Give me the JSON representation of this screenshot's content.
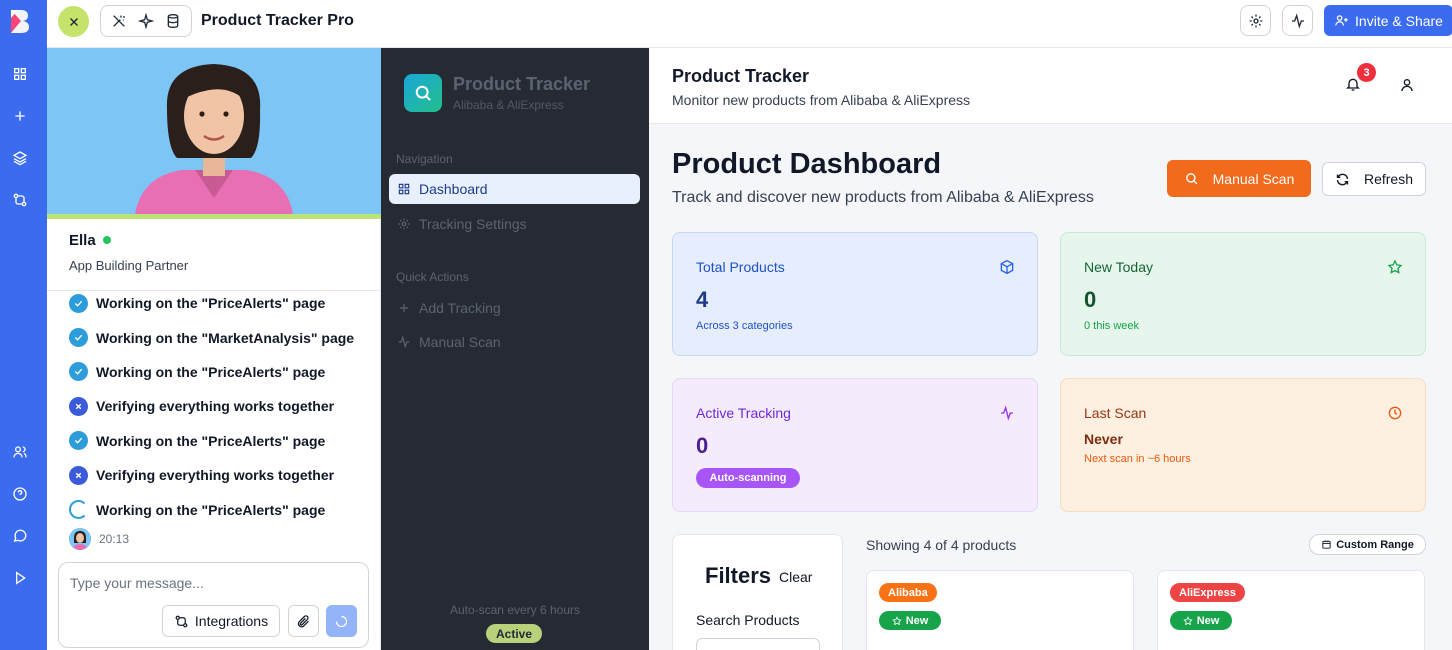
{
  "topbar": {
    "app_title": "Product Tracker Pro",
    "invite_label": "Invite & Share"
  },
  "agent": {
    "name": "Ella",
    "role": "App Building Partner",
    "steps": [
      {
        "status": "done",
        "label": "Working on the \"PriceAlerts\" page"
      },
      {
        "status": "done",
        "label": "Working on the \"MarketAnalysis\" page"
      },
      {
        "status": "done",
        "label": "Working on the \"PriceAlerts\" page"
      },
      {
        "status": "failed",
        "label": "Verifying everything works together"
      },
      {
        "status": "done",
        "label": "Working on the \"PriceAlerts\" page"
      },
      {
        "status": "failed",
        "label": "Verifying everything works together"
      },
      {
        "status": "in-progress",
        "label": "Working on the \"PriceAlerts\" page"
      }
    ],
    "message_time": "20:13",
    "composer": {
      "placeholder": "Type your message...",
      "integrations_label": "Integrations"
    }
  },
  "sidebar": {
    "brand_name": "Product Tracker",
    "brand_sub": "Alibaba & AliExpress",
    "nav_heading": "Navigation",
    "nav_items": [
      {
        "label": "Dashboard",
        "icon": "grid-icon",
        "active": true
      },
      {
        "label": "Tracking Settings",
        "icon": "gear-icon",
        "active": false
      }
    ],
    "quick_heading": "Quick Actions",
    "quick_items": [
      {
        "label": "Add Tracking",
        "icon": "plus-icon"
      },
      {
        "label": "Manual Scan",
        "icon": "activity-icon"
      }
    ],
    "autoscan_text": "Auto-scan every 6 hours",
    "status_pill": "Active"
  },
  "header": {
    "title": "Product Tracker",
    "subtitle": "Monitor new products from Alibaba & AliExpress",
    "notification_count": "3"
  },
  "dashboard": {
    "title": "Product Dashboard",
    "subtitle": "Track and discover new products from Alibaba & AliExpress",
    "manual_scan_label": "Manual Scan",
    "refresh_label": "Refresh",
    "stats": {
      "total": {
        "label": "Total Products",
        "value": "4",
        "sub": "Across 3 categories",
        "icon": "cube-icon"
      },
      "new_today": {
        "label": "New Today",
        "value": "0",
        "sub": "0 this week",
        "icon": "star-icon"
      },
      "active": {
        "label": "Active Tracking",
        "value": "0",
        "pill": "Auto-scanning",
        "icon": "activity-icon"
      },
      "last_scan": {
        "label": "Last Scan",
        "value": "Never",
        "sub": "Next scan in ~6 hours",
        "icon": "clock-icon"
      }
    },
    "filters": {
      "title": "Filters",
      "clear_label": "Clear",
      "search_label": "Search Products"
    },
    "showing_text": "Showing 4 of 4 products",
    "range_label": "Custom Range",
    "products": [
      {
        "source": "Alibaba",
        "source_color": "#f97316",
        "badge": "New"
      },
      {
        "source": "AliExpress",
        "source_color": "#ef4444",
        "badge": "New"
      }
    ]
  },
  "colors": {
    "rail": "#3b6cf0",
    "accent_orange": "#f26a1c",
    "sidebar_bg": "#262a33"
  }
}
